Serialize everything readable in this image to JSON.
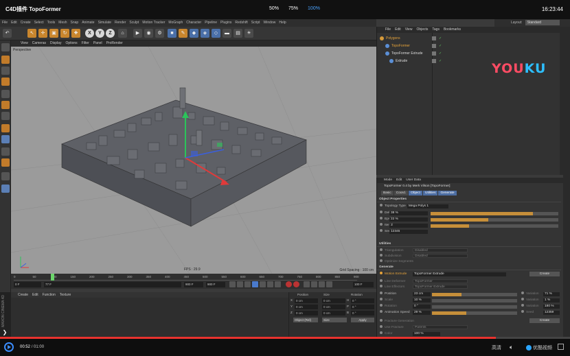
{
  "player": {
    "title": "C4D插件 TopoFormer",
    "zoom_levels": [
      "50%",
      "75%",
      "100%"
    ],
    "active_zoom": "100%",
    "clock": "16:23:44",
    "time_current": "00:52",
    "time_total": "/ 01:00",
    "quality_label": "高清",
    "brand_label": "优酷视频",
    "progress_pct": 87
  },
  "c4d": {
    "menus": [
      "File",
      "Edit",
      "Create",
      "Select",
      "Tools",
      "Mesh",
      "Snap",
      "Animate",
      "Simulate",
      "Render",
      "Sculpt",
      "Motion Tracker",
      "MoGraph",
      "Character",
      "Pipeline",
      "Plugins",
      "Redshift",
      "Script",
      "Window",
      "Help"
    ],
    "layout_label": "Layout:",
    "layout_value": "Standard",
    "viewport_menus": [
      "View",
      "Cameras",
      "Display",
      "Options",
      "Filter",
      "Panel",
      "ProRender"
    ],
    "viewport_label": "Perspective",
    "fps_label": "FPS : 29.9",
    "grid_label": "Grid Spacing : 100 cm",
    "timeline_ticks": [
      "0",
      "50",
      "100",
      "150",
      "200",
      "250",
      "300",
      "350",
      "400",
      "450",
      "500",
      "550",
      "600",
      "650",
      "700",
      "750",
      "800",
      "850",
      "900"
    ],
    "timeline_current": "77 F",
    "timeline_start": "0 F",
    "timeline_end": "900 F",
    "timeline_end2": "900 F",
    "timeline_frame_right": "100 F",
    "material_menus": [
      "Create",
      "Edit",
      "Function",
      "Texture"
    ],
    "coord_headers": [
      "Position",
      "Size",
      "Rotation"
    ],
    "coord_rows": [
      {
        "axis": "X",
        "pos": "0 cm",
        "size": "0 cm",
        "rot_axis": "H",
        "rot": "0 °"
      },
      {
        "axis": "Y",
        "pos": "0 cm",
        "size": "0 cm",
        "rot_axis": "P",
        "rot": "0 °"
      },
      {
        "axis": "Z",
        "pos": "0 cm",
        "size": "0 cm",
        "rot_axis": "B",
        "rot": "0 °"
      }
    ],
    "coord_mode": "Object (Rel)",
    "coord_size": "Size",
    "coord_apply": "Apply",
    "maxon_label": "MAXON CINEMA 4D"
  },
  "object_manager": {
    "menus": [
      "File",
      "Edit",
      "View",
      "Objects",
      "Tags",
      "Bookmarks"
    ],
    "objects": [
      {
        "name": "Polygons",
        "highlight": true
      },
      {
        "name": "TopoFormer",
        "highlight": true
      },
      {
        "name": "TopoFormer Extrude",
        "highlight": false
      },
      {
        "name": "Extrude",
        "highlight": false
      }
    ],
    "watermark_left": "YOU",
    "watermark_right": "KU"
  },
  "attributes": {
    "menus": [
      "Mode",
      "Edit",
      "User Data"
    ],
    "object_title": "TopoFormer 0.4 by Merk Vilson [TopoFormer]",
    "tabs": [
      "Basic",
      "Coord.",
      "Object",
      "Utilities",
      "Generate"
    ],
    "active_tabs": [
      "Object",
      "Utilities",
      "Generate"
    ],
    "section_object": "Object Properties",
    "topology_label": "Topology Type",
    "topology_value": "Mega Polys 1",
    "params": [
      {
        "label": "Delta",
        "value": "38 %",
        "fill_pct": 80
      },
      {
        "label": "Epsilon",
        "value": "22 %",
        "fill_pct": 45
      },
      {
        "label": "Iterations",
        "value": "3",
        "fill_pct": 30
      },
      {
        "label": "Seed",
        "value": "12345",
        "fill_pct": 0
      }
    ],
    "section_utilities": "Utilities",
    "util_rows": [
      {
        "label": "Triangulation",
        "value": "Disabled"
      },
      {
        "label": "Subdivision",
        "value": "Disabled"
      },
      {
        "label": "Optimize Segments",
        "value": ""
      }
    ],
    "section_generate": "Generate",
    "motion_extrude_label": "Motion Extrude",
    "motion_extrude_value": "TopoFormer Extrude",
    "create_label": "Create",
    "line_rows": [
      {
        "label": "Line Deformer",
        "value": "TopoFormer"
      },
      {
        "label": "Line Effectors",
        "value": "TopoFormer Extrude"
      }
    ],
    "gen_params": [
      {
        "label": "Position",
        "value": "23 cm",
        "fill_pct": 35
      },
      {
        "label": "Scale",
        "value": "10 %",
        "fill_pct": 0
      },
      {
        "label": "Rotation",
        "value": "0 °",
        "fill_pct": 0
      },
      {
        "label": "Animation Speed",
        "value": "29 %",
        "fill_pct": 40
      }
    ],
    "variation_rows": [
      {
        "label": "Variation",
        "value": "71 %"
      },
      {
        "label": "Variation",
        "value": "1 %"
      },
      {
        "label": "Variation",
        "value": "180 %"
      },
      {
        "label": "Seed",
        "value": "12359"
      }
    ],
    "fracture_label": "Fracture Generation",
    "fracture_button": "Create",
    "use_fracture_label": "Use Fracture",
    "use_fracture_value": "Parents",
    "color_label": "Color",
    "color_value": "100 %"
  }
}
